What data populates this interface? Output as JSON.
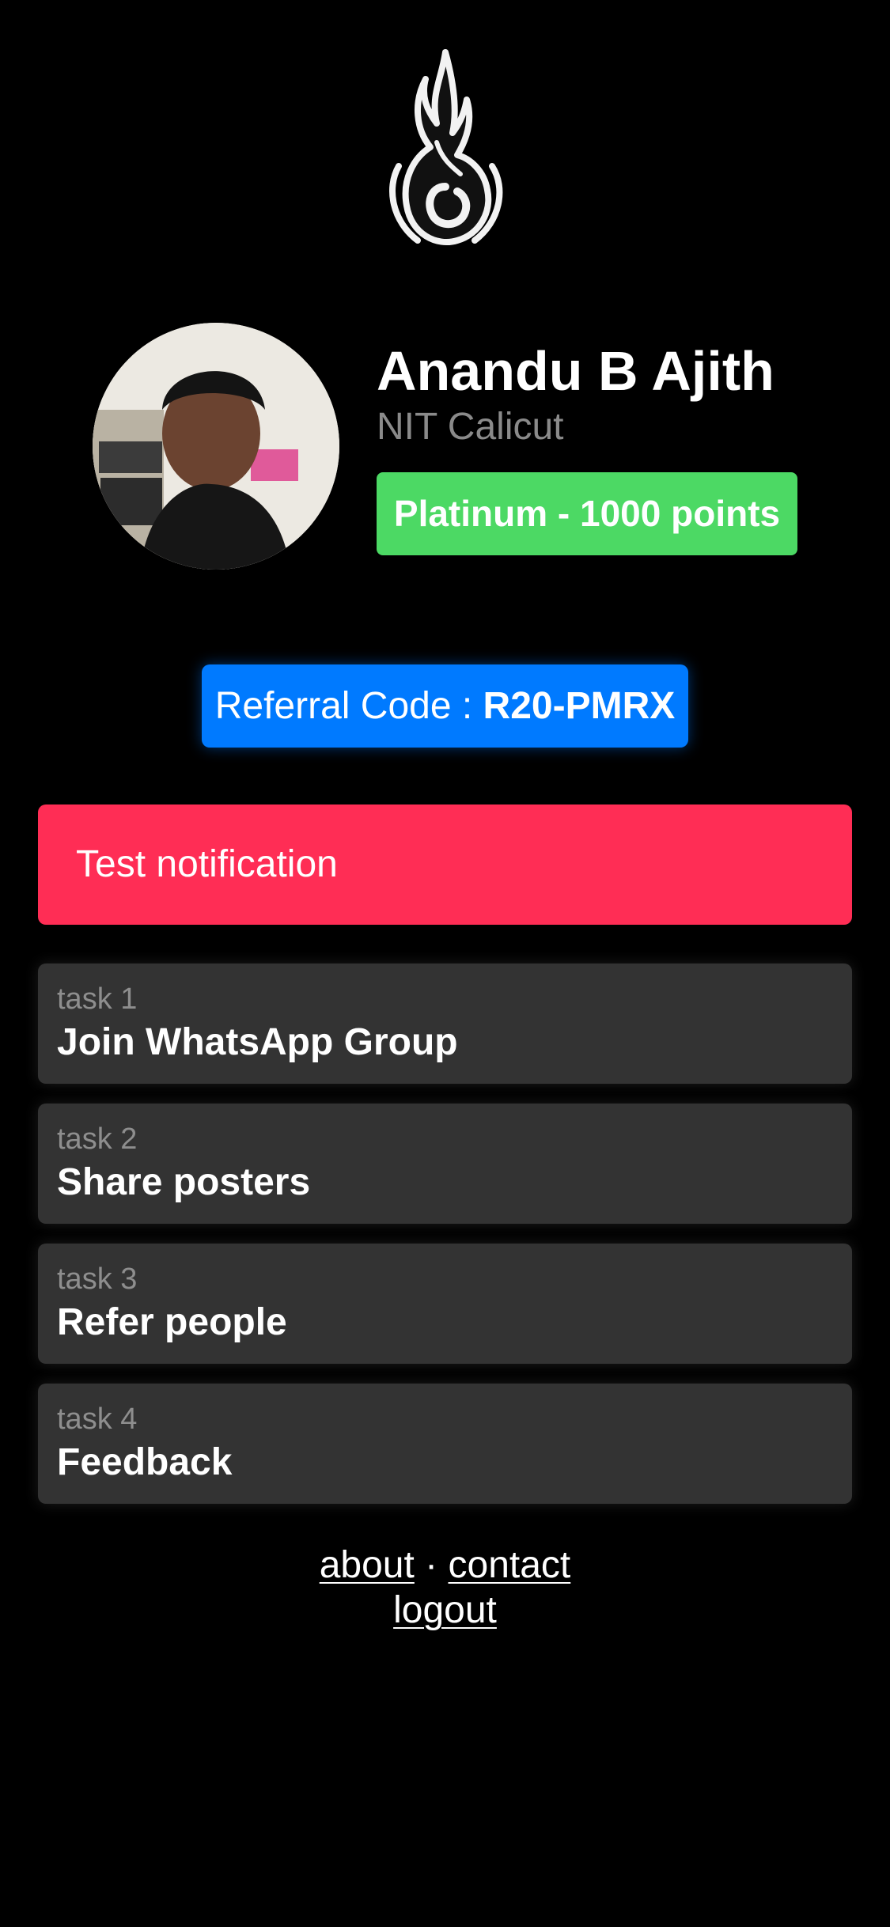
{
  "logo": {
    "icon": "flame-logo-icon"
  },
  "profile": {
    "name": "Anandu B Ajith",
    "college": "NIT Calicut",
    "badge": "Platinum - 1000 points",
    "badge_color": "#4cd964"
  },
  "referral": {
    "label": "Referral Code : ",
    "code": "R20-PMRX",
    "color": "#007aff"
  },
  "notification": {
    "text": "Test notification",
    "color": "#ff2d55"
  },
  "tasks": [
    {
      "number": "task 1",
      "title": "Join WhatsApp Group"
    },
    {
      "number": "task 2",
      "title": "Share posters"
    },
    {
      "number": "task 3",
      "title": "Refer people"
    },
    {
      "number": "task 4",
      "title": "Feedback"
    }
  ],
  "footer": {
    "about": "about",
    "separator": " · ",
    "contact": "contact",
    "logout": "logout"
  }
}
